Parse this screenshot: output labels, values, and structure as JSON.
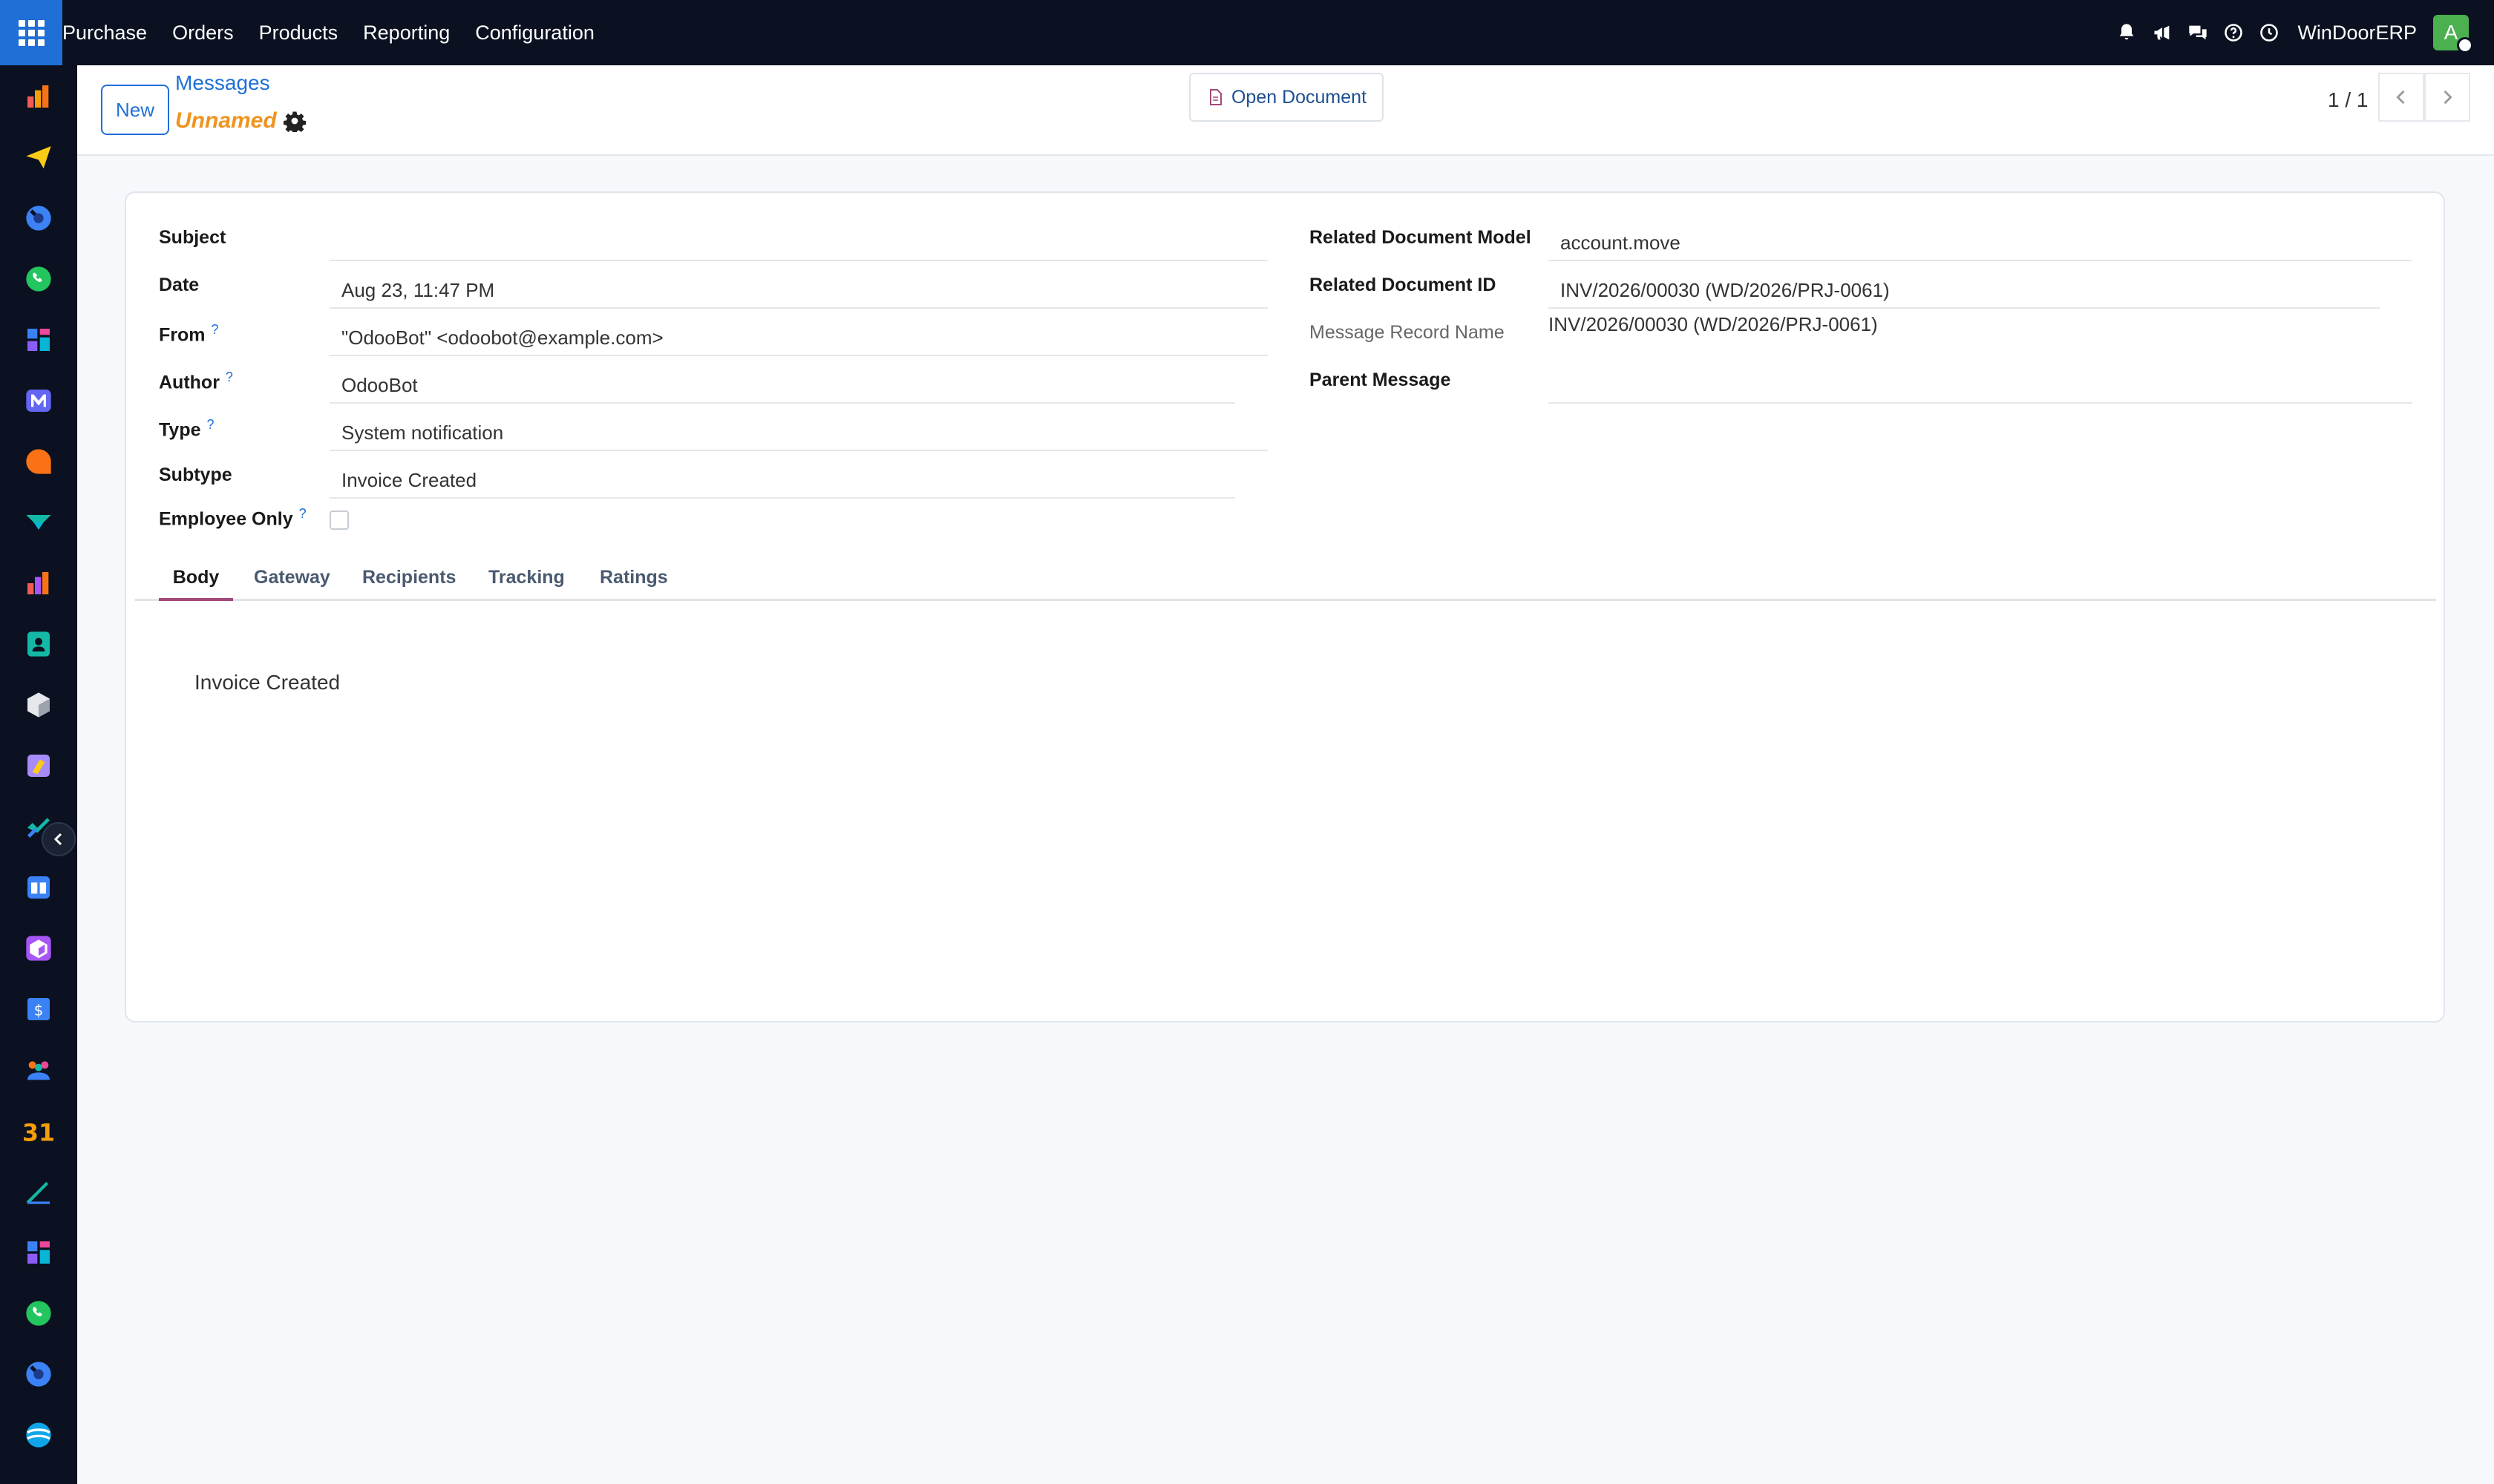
{
  "navbar": {
    "menu": [
      "Purchase",
      "Orders",
      "Products",
      "Reporting",
      "Configuration"
    ],
    "company": "WinDoorERP",
    "avatar_initial": "A",
    "icons": [
      "bell-icon",
      "megaphone-icon",
      "chat-icon",
      "help-icon",
      "clock-icon"
    ]
  },
  "sidebar": {
    "apps": [
      "purchase-app",
      "discuss-app",
      "timesheet-app",
      "whatsapp-app",
      "dashboards-app",
      "email-marketing-app",
      "live-chat-app",
      "planning-app",
      "reporting-app",
      "contacts-app",
      "inventory-app",
      "art-app",
      "project-app",
      "knowledge-app",
      "packaging-app",
      "sales-app",
      "employees-app",
      "calendar-app",
      "sign-app",
      "dashboards-app-2",
      "whatsapp-app-2",
      "timesheet-app-2",
      "field-service-app"
    ]
  },
  "control_panel": {
    "new_label": "New",
    "breadcrumb": "Messages",
    "record_name": "Unnamed",
    "open_document_label": "Open Document",
    "pager": "1 / 1"
  },
  "form": {
    "left": {
      "subject": {
        "label": "Subject",
        "value": ""
      },
      "date": {
        "label": "Date",
        "value": "Aug 23, 11:47 PM"
      },
      "from": {
        "label": "From",
        "value": "\"OdooBot\" <odoobot@example.com>"
      },
      "author": {
        "label": "Author",
        "value": "OdooBot"
      },
      "type": {
        "label": "Type",
        "value": "System notification"
      },
      "subtype": {
        "label": "Subtype",
        "value": "Invoice Created"
      },
      "employee_only": {
        "label": "Employee Only",
        "checked": false
      }
    },
    "right": {
      "related_model": {
        "label": "Related Document Model",
        "value": "account.move"
      },
      "related_id": {
        "label": "Related Document ID",
        "value": "INV/2026/00030 (WD/2026/PRJ-0061)"
      },
      "record_name": {
        "label": "Message Record Name",
        "value": "INV/2026/00030 (WD/2026/PRJ-0061)"
      },
      "parent_message": {
        "label": "Parent Message",
        "value": ""
      }
    },
    "help_mark": "?",
    "tabs": [
      "Body",
      "Gateway",
      "Recipients",
      "Tracking",
      "Ratings"
    ],
    "active_tab": "Body",
    "body": "Invoice Created"
  }
}
